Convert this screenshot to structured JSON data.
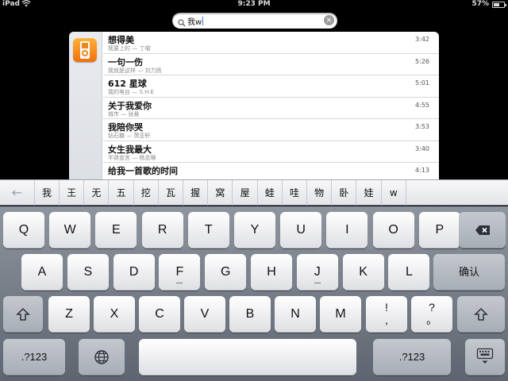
{
  "status_bar": {
    "carrier": "iPad",
    "time": "9:23 PM",
    "battery_percent_label": "57%",
    "battery_fraction": 0.57
  },
  "search": {
    "query": "我w",
    "clear_icon": "clear-icon",
    "search_icon": "search-icon"
  },
  "results": {
    "app_icon": "music-app-icon",
    "rows": [
      {
        "title": "想得美",
        "subtitle": "我要上的 — 丁噹",
        "duration": "3:42"
      },
      {
        "title": "一句一伤",
        "subtitle": "我就是这样 — 刘力扬",
        "duration": "5:26"
      },
      {
        "title": "612 星球",
        "subtitle": "我的电台 — S.H.E",
        "duration": "5:01"
      },
      {
        "title": "关于我爱你",
        "subtitle": "城市 — 张悬",
        "duration": "4:55"
      },
      {
        "title": "我陪你哭",
        "subtitle": "钻石糖 — 萧亚轩",
        "duration": "3:53"
      },
      {
        "title": "女生我最大",
        "subtitle": "半熟宣言 — 杨丞琳",
        "duration": "3:40"
      },
      {
        "title": "给我一首歌的时间",
        "subtitle": "",
        "duration": "4:13"
      }
    ]
  },
  "candidates": {
    "back_label": "←",
    "items": [
      "我",
      "王",
      "无",
      "五",
      "挖",
      "瓦",
      "握",
      "窝",
      "屋",
      "蛙",
      "哇",
      "物",
      "卧",
      "娃",
      "w"
    ]
  },
  "keyboard": {
    "row1": [
      "Q",
      "W",
      "E",
      "R",
      "T",
      "Y",
      "U",
      "I",
      "O",
      "P"
    ],
    "row2": [
      "A",
      "S",
      "D",
      "F",
      "G",
      "H",
      "J",
      "K",
      "L"
    ],
    "row3": [
      "Z",
      "X",
      "C",
      "V",
      "B",
      "N",
      "M"
    ],
    "confirm_label": "确认",
    "excl_top": "!",
    "excl_bottom": ",",
    "question_top": "?",
    "question_bottom": "。",
    "numbers_label": ".?123",
    "globe_icon": "globe-icon",
    "delete_icon": "delete-icon",
    "shift_icon": "shift-icon",
    "hide_keyboard_icon": "hide-keyboard-icon"
  }
}
